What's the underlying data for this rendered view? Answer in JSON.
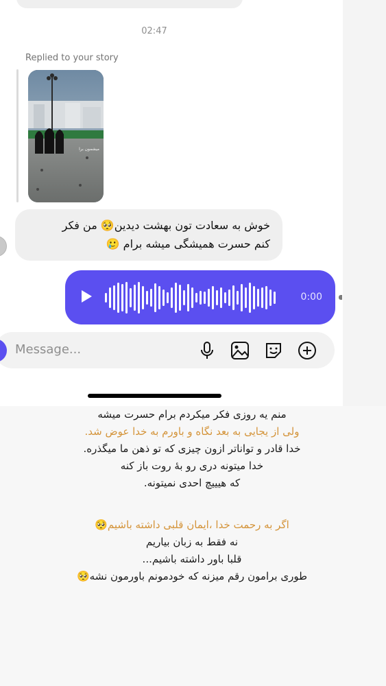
{
  "chat": {
    "timestamp": "02:47",
    "replied_label": "Replied to your story",
    "story_caption": "میشمون برا",
    "incoming_message": {
      "line1": "خوش به سعادت تون بهشت دیدین🥺 من فکر",
      "line2": "کنم حسرت همیشگی میشه برام 🥲"
    },
    "voice_message": {
      "duration": "0:00"
    },
    "composer": {
      "placeholder": "Message...",
      "icons": [
        "microphone-icon",
        "image-icon",
        "sticker-icon",
        "plus-circle-icon"
      ]
    }
  },
  "note_text": {
    "block1": [
      "منم یه روزی فکر میکردم برام حسرت میشه",
      "ولی از یجایی به بعد نگاه و باورم به خدا عوض شد.",
      "خدا قادر و تواناتر ازون چیزی که تو ذهن ما میگذره.",
      "خدا میتونه دری رو بهٔ روت باز کنه",
      "که هیییچ احدی نمیتونه."
    ],
    "block2": [
      "اگر به رحمت خدا ،ایمان قلبی داشته باشیم🥺",
      "نه فقط به زبان بیاریم",
      "قلبا باور داشته باشیم...",
      "طوری برامون رقم میزنه که  خودمونم باورمون نشه🥺"
    ]
  },
  "colors": {
    "voice_bubble": "#5b4ff0",
    "highlight_text": "#d4943a",
    "incoming_bubble": "#efefef"
  }
}
